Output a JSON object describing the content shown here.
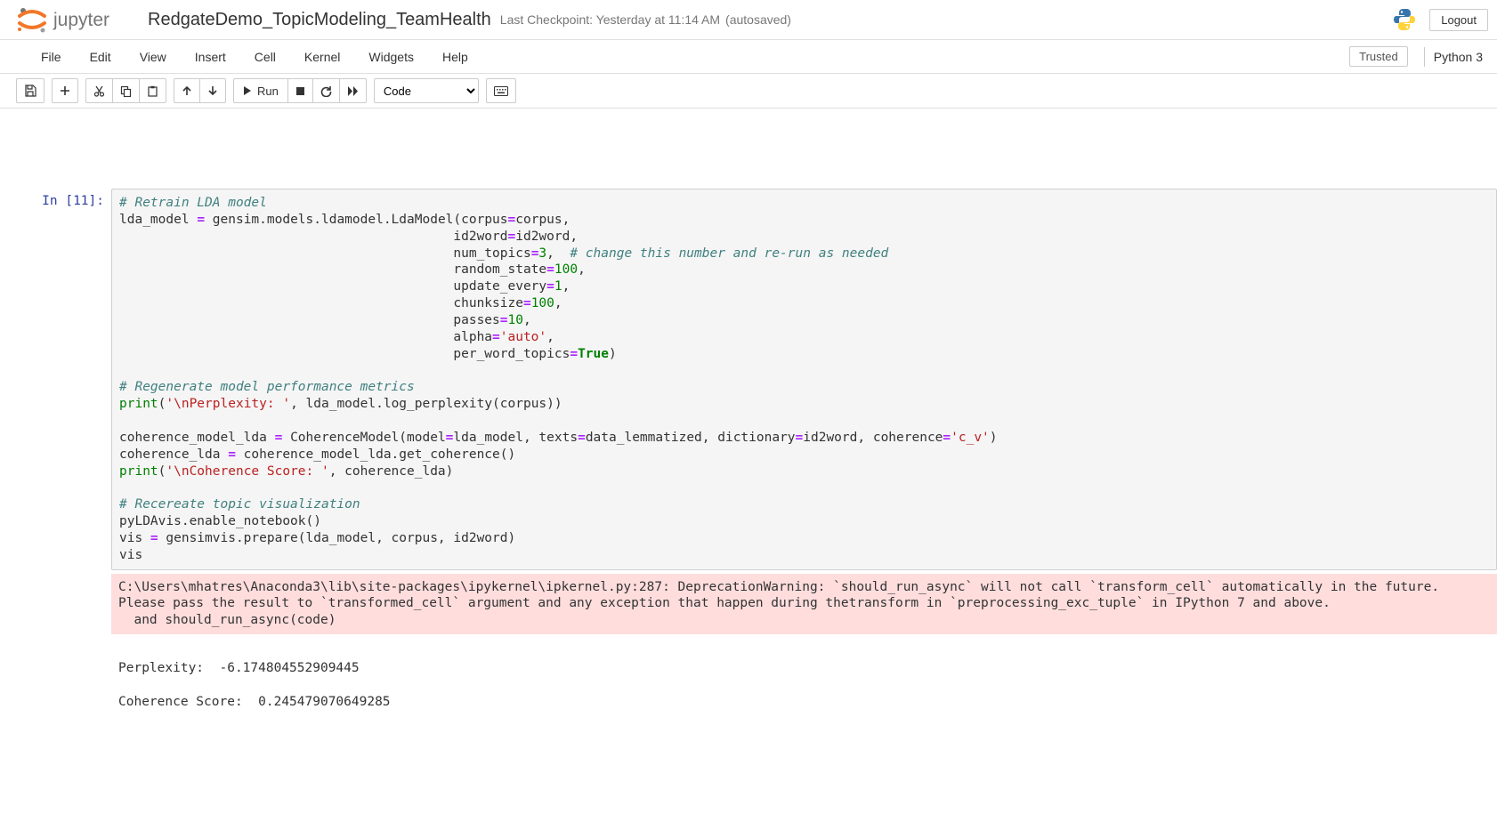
{
  "header": {
    "notebook_title": "RedgateDemo_TopicModeling_TeamHealth",
    "checkpoint": "Last Checkpoint: Yesterday at 11:14 AM",
    "autosave": "(autosaved)",
    "logout": "Logout"
  },
  "menubar": {
    "items": [
      "File",
      "Edit",
      "View",
      "Insert",
      "Cell",
      "Kernel",
      "Widgets",
      "Help"
    ],
    "trusted": "Trusted",
    "kernel": "Python 3"
  },
  "toolbar": {
    "run_label": "Run",
    "cell_type": "Code"
  },
  "cell": {
    "prompt": "In [11]:",
    "code_lines": [
      {
        "t": "comment",
        "s": "# Retrain LDA model"
      },
      {
        "t": "code",
        "s": "lda_model = gensim.models.ldamodel.LdaModel(corpus=corpus,"
      },
      {
        "t": "code",
        "s": "                                           id2word=id2word,"
      },
      {
        "t": "code",
        "s": "                                           num_topics=3,  ",
        "c": "# change this number and re-run as needed"
      },
      {
        "t": "code",
        "s": "                                           random_state=100,"
      },
      {
        "t": "code",
        "s": "                                           update_every=1,"
      },
      {
        "t": "code",
        "s": "                                           chunksize=100,"
      },
      {
        "t": "code",
        "s": "                                           passes=10,"
      },
      {
        "t": "code",
        "s": "                                           alpha=",
        "str": "'auto'",
        "s2": ","
      },
      {
        "t": "code",
        "s": "                                           per_word_topics=",
        "kw": "True",
        "s2": ")"
      },
      {
        "t": "blank",
        "s": ""
      },
      {
        "t": "comment",
        "s": "# Regenerate model performance metrics"
      },
      {
        "t": "print",
        "pre": "print(",
        "str": "'\\nPerplexity: '",
        "post": ", lda_model.log_perplexity(corpus))"
      },
      {
        "t": "blank",
        "s": ""
      },
      {
        "t": "code",
        "s": "coherence_model_lda = CoherenceModel(model=lda_model, texts=data_lemmatized, dictionary=id2word, coherence=",
        "str": "'c_v'",
        "s2": ")"
      },
      {
        "t": "code",
        "s": "coherence_lda = coherence_model_lda.get_coherence()"
      },
      {
        "t": "print",
        "pre": "print(",
        "str": "'\\nCoherence Score: '",
        "post": ", coherence_lda)"
      },
      {
        "t": "blank",
        "s": ""
      },
      {
        "t": "comment",
        "s": "# Recereate topic visualization"
      },
      {
        "t": "code",
        "s": "pyLDAvis.enable_notebook()"
      },
      {
        "t": "code",
        "s": "vis = gensimvis.prepare(lda_model, corpus, id2word)"
      },
      {
        "t": "code",
        "s": "vis"
      }
    ]
  },
  "output": {
    "stderr": "C:\\Users\\mhatres\\Anaconda3\\lib\\site-packages\\ipykernel\\ipkernel.py:287: DeprecationWarning: `should_run_async` will not call `transform_cell` automatically in the future. Please pass the result to `transformed_cell` argument and any exception that happen during thetransform in `preprocessing_exc_tuple` in IPython 7 and above.\n  and should_run_async(code)",
    "stdout": "\nPerplexity:  -6.174804552909445\n\nCoherence Score:  0.245479070649285"
  }
}
